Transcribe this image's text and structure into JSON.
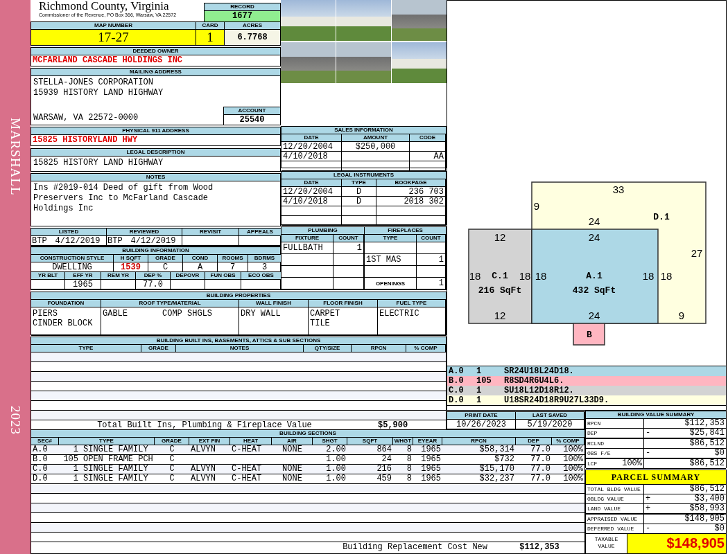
{
  "sidebar": {
    "district": "MARSHALL",
    "year": "2023"
  },
  "header": {
    "county": "Richmond County, Virginia",
    "office": "Commissioner of the Revenue, PO Box 366, Warsaw, VA 22572",
    "record_label": "RECORD",
    "record": "1677"
  },
  "parcel": {
    "map_number_label": "MAP NUMBER",
    "map_number": "17-27",
    "card_label": "CARD",
    "card": "1",
    "acres_label": "ACRES",
    "acres": "6.7768"
  },
  "owner": {
    "label": "DEEDED OWNER",
    "name": "MCFARLAND CASCADE HOLDINGS INC"
  },
  "mailing": {
    "label": "MAILING ADDRESS",
    "lines": [
      "STELLA-JONES CORPORATION",
      "15939 HISTORY LAND HIGHWAY"
    ],
    "city_state_zip": "WARSAW, VA 22572-0000",
    "account_label": "ACCOUNT",
    "account": "25540"
  },
  "physical_address": {
    "label": "PHYSICAL 911 ADDRESS",
    "value": "15825 HISTORYLAND HWY"
  },
  "legal_description": {
    "label": "LEGAL DESCRIPTION",
    "value": "15825 HISTORY LAND HIGHWAY"
  },
  "notes": {
    "label": "NOTES",
    "value": "Ins #2019-014 Deed of gift from Wood Preservers Inc to McFarland Cascade Holdings Inc"
  },
  "review": [
    {
      "label": "LISTED",
      "initials": "BTP",
      "date": "4/12/2019"
    },
    {
      "label": "REVIEWED",
      "initials": "BTP",
      "date": "4/12/2019"
    },
    {
      "label": "REVISIT"
    },
    {
      "label": "APPEALS"
    }
  ],
  "building_information": {
    "title": "BUILDING INFORMATION",
    "row_1": [
      {
        "label": "CONSTRUCTION STYLE",
        "value": "DWELLING",
        "emphasis": false
      },
      {
        "label": "H SQFT",
        "value": "1539",
        "emphasis": true
      },
      {
        "label": "GRADE",
        "value": "C",
        "emphasis": false
      },
      {
        "label": "COND",
        "value": "A",
        "emphasis": false
      },
      {
        "label": "ROOMS",
        "value": "7",
        "emphasis": false
      },
      {
        "label": "BDRMS",
        "value": "3",
        "emphasis": false
      }
    ],
    "row_2": [
      {
        "label": "YR BLT"
      },
      {
        "label": "EFF YR",
        "value": "1965"
      },
      {
        "label": "REM YR"
      },
      {
        "label": "DEP %",
        "value": "77.0"
      },
      {
        "label": "DEPOVR"
      },
      {
        "label": "FUN OBS"
      },
      {
        "label": "ECO OBS"
      }
    ]
  },
  "photos": [
    {
      "kind": "house"
    },
    {
      "kind": "house"
    },
    {
      "kind": "shed"
    },
    {
      "kind": "shed"
    },
    {
      "kind": "shed"
    },
    {
      "kind": "house"
    }
  ],
  "sales": {
    "title": "SALES INFORMATION",
    "columns": [
      "DATE",
      "AMOUNT",
      "CODE"
    ],
    "rows": [
      {
        "date": "12/20/2004",
        "amount": "$250,000"
      },
      {
        "date": "4/10/2018",
        "code": "AA"
      }
    ]
  },
  "legal_instruments": {
    "title": "LEGAL INSTRUMENTS",
    "columns": [
      "DATE",
      "TYPE",
      "BOOKPAGE"
    ],
    "rows": [
      {
        "date": "12/20/2004",
        "type": "D",
        "bookpage": "236 703"
      },
      {
        "date": "4/10/2018",
        "type": "D",
        "bookpage": "2018 302"
      }
    ]
  },
  "plumbing": {
    "title": "PLUMBING",
    "columns": [
      "FIXTURE",
      "COUNT"
    ],
    "rows": [
      {
        "fixture": "FULLBATH",
        "count": "1"
      }
    ]
  },
  "fireplaces": {
    "title": "FIREPLACES",
    "columns": [
      "TYPE",
      "COUNT"
    ],
    "rows": [
      {
        "type": "1ST MAS",
        "count": "1"
      }
    ],
    "openings_label": "OPENINGS",
    "openings": "1"
  },
  "building_properties": {
    "title": "BUILDING PROPERTIES",
    "columns": [
      {
        "kind": "list",
        "label": "FOUNDATION",
        "lines": [
          "PIERS",
          "CINDER BLOCK"
        ]
      },
      {
        "kind": "split",
        "label": "ROOF TYPE/MATERIAL",
        "left": "GABLE",
        "right": "COMP SHGLS"
      },
      {
        "kind": "list",
        "label": "WALL FINISH",
        "lines": [
          "DRY WALL"
        ]
      },
      {
        "kind": "list",
        "label": "FLOOR FINISH",
        "lines": [
          "CARPET",
          "TILE"
        ]
      },
      {
        "kind": "list",
        "label": "FUEL TYPE",
        "lines": [
          "ELECTRIC"
        ]
      }
    ]
  },
  "built_ins": {
    "title": "BUILDING BUILT INS, BASEMENTS, ATTICS & SUB SECTIONS",
    "columns": [
      "TYPE",
      "GRADE",
      "NOTES",
      "QTY/SIZE",
      "RPCN",
      "% COMP"
    ],
    "total_label": "Total Built Ins, Plumbing & Fireplace Value",
    "total": "$5,900"
  },
  "sketch": {
    "areas": [
      {
        "label": "C.1",
        "area": "216 SqFt",
        "color": "#d3d3d3",
        "dims": [
          "12",
          "18",
          "18",
          "12"
        ]
      },
      {
        "label": "D.1",
        "color": "#ffffe0",
        "dims": [
          "33",
          "9",
          "24",
          "27",
          "18",
          "9"
        ]
      },
      {
        "label": "A.1",
        "area": "432 SqFt",
        "color": "#add8e6",
        "dims": [
          "24",
          "18",
          "18",
          "24"
        ]
      },
      {
        "label": "B",
        "color": "#ffb6c1"
      }
    ],
    "legend": [
      {
        "section": "A.0",
        "code": "1",
        "vectors": "SR24U18L24D18.",
        "color": "#add8e6"
      },
      {
        "section": "B.0",
        "code": "105",
        "vectors": "R8SD4R6U4L6.",
        "color": "#ffb6c1"
      },
      {
        "section": "C.0",
        "code": "1",
        "vectors": "SU18L12D18R12.",
        "color": "#d3d3d3"
      },
      {
        "section": "D.0",
        "code": "1",
        "vectors": "U18SR24D18R9U27L33D9.",
        "color": "#ffffe0"
      }
    ]
  },
  "dates": [
    {
      "label": "PRINT DATE",
      "value": "10/26/2023"
    },
    {
      "label": "LAST SAVED",
      "value": "5/19/2020"
    }
  ],
  "building_sections": {
    "title": "BUILDING SECTIONS",
    "columns": [
      "SEC#",
      "TYPE",
      "GRADE",
      "EXT FIN",
      "HEAT",
      "AIR",
      "SHGT",
      "SQFT",
      "WHGT",
      "EYEAR",
      "RPCN",
      "DEP",
      "% COMP"
    ],
    "rows": [
      {
        "sec": "A.0",
        "code": "1",
        "type": "SINGLE FAMILY",
        "grade": "C",
        "ext_fin": "ALVYN",
        "heat": "C-HEAT",
        "air": "NONE",
        "shgt": "2.00",
        "sqft": "864",
        "whgt": "8",
        "eyear": "1965",
        "rpcn": "$58,314",
        "dep": "77.0",
        "comp": "100%"
      },
      {
        "sec": "B.0",
        "code": "105",
        "type": "OPEN FRAME PCH",
        "grade": "C",
        "shgt": "1.00",
        "sqft": "24",
        "whgt": "8",
        "eyear": "1965",
        "rpcn": "$732",
        "dep": "77.0",
        "comp": "100%"
      },
      {
        "sec": "C.0",
        "code": "1",
        "type": "SINGLE FAMILY",
        "grade": "C",
        "ext_fin": "ALVYN",
        "heat": "C-HEAT",
        "air": "NONE",
        "shgt": "1.00",
        "sqft": "216",
        "whgt": "8",
        "eyear": "1965",
        "rpcn": "$15,170",
        "dep": "77.0",
        "comp": "100%"
      },
      {
        "sec": "D.0",
        "code": "1",
        "type": "SINGLE FAMILY",
        "grade": "C",
        "ext_fin": "ALVYN",
        "heat": "C-HEAT",
        "air": "NONE",
        "shgt": "1.00",
        "sqft": "459",
        "whgt": "8",
        "eyear": "1965",
        "rpcn": "$32,237",
        "dep": "77.0",
        "comp": "100%"
      }
    ],
    "total_label": "Building Replacement Cost New",
    "total": "$112,353"
  },
  "building_value_summary": {
    "title": "BUILDING VALUE SUMMARY",
    "rows": [
      {
        "label": "RPCN",
        "value": "$112,353",
        "subtotal": false
      },
      {
        "label": "DEP",
        "sign": "-",
        "value": "$25,841",
        "subtotal": false
      },
      {
        "label": "RCLND",
        "value": "$86,512",
        "subtotal": true
      },
      {
        "label": "OBS F/E",
        "sign": "-",
        "value": "$0",
        "subtotal": false
      },
      {
        "label": "LCF",
        "extra": "100%",
        "value": "$86,512",
        "subtotal": true
      }
    ]
  },
  "parcel_summary": {
    "title": "PARCEL SUMMARY",
    "rows": [
      {
        "kind": "line",
        "label": "TOTAL BLDG VALUE",
        "value": "$86,512",
        "subtotal": false
      },
      {
        "kind": "line",
        "label": "OBLDG VALUE",
        "sign": "+",
        "value": "$3,400",
        "subtotal": false
      },
      {
        "kind": "line",
        "label": "LAND VALUE",
        "sign": "+",
        "value": "$58,993",
        "subtotal": false
      },
      {
        "kind": "line",
        "label": "APPRAISED VALUE",
        "value": "$148,905",
        "subtotal": true
      },
      {
        "kind": "line",
        "label": "DEFERRED VALUE",
        "sign": "-",
        "value": "$0",
        "subtotal": false
      },
      {
        "kind": "total",
        "label": "TAXABLE VALUE",
        "value": "$148,905",
        "subtotal": false
      }
    ]
  }
}
